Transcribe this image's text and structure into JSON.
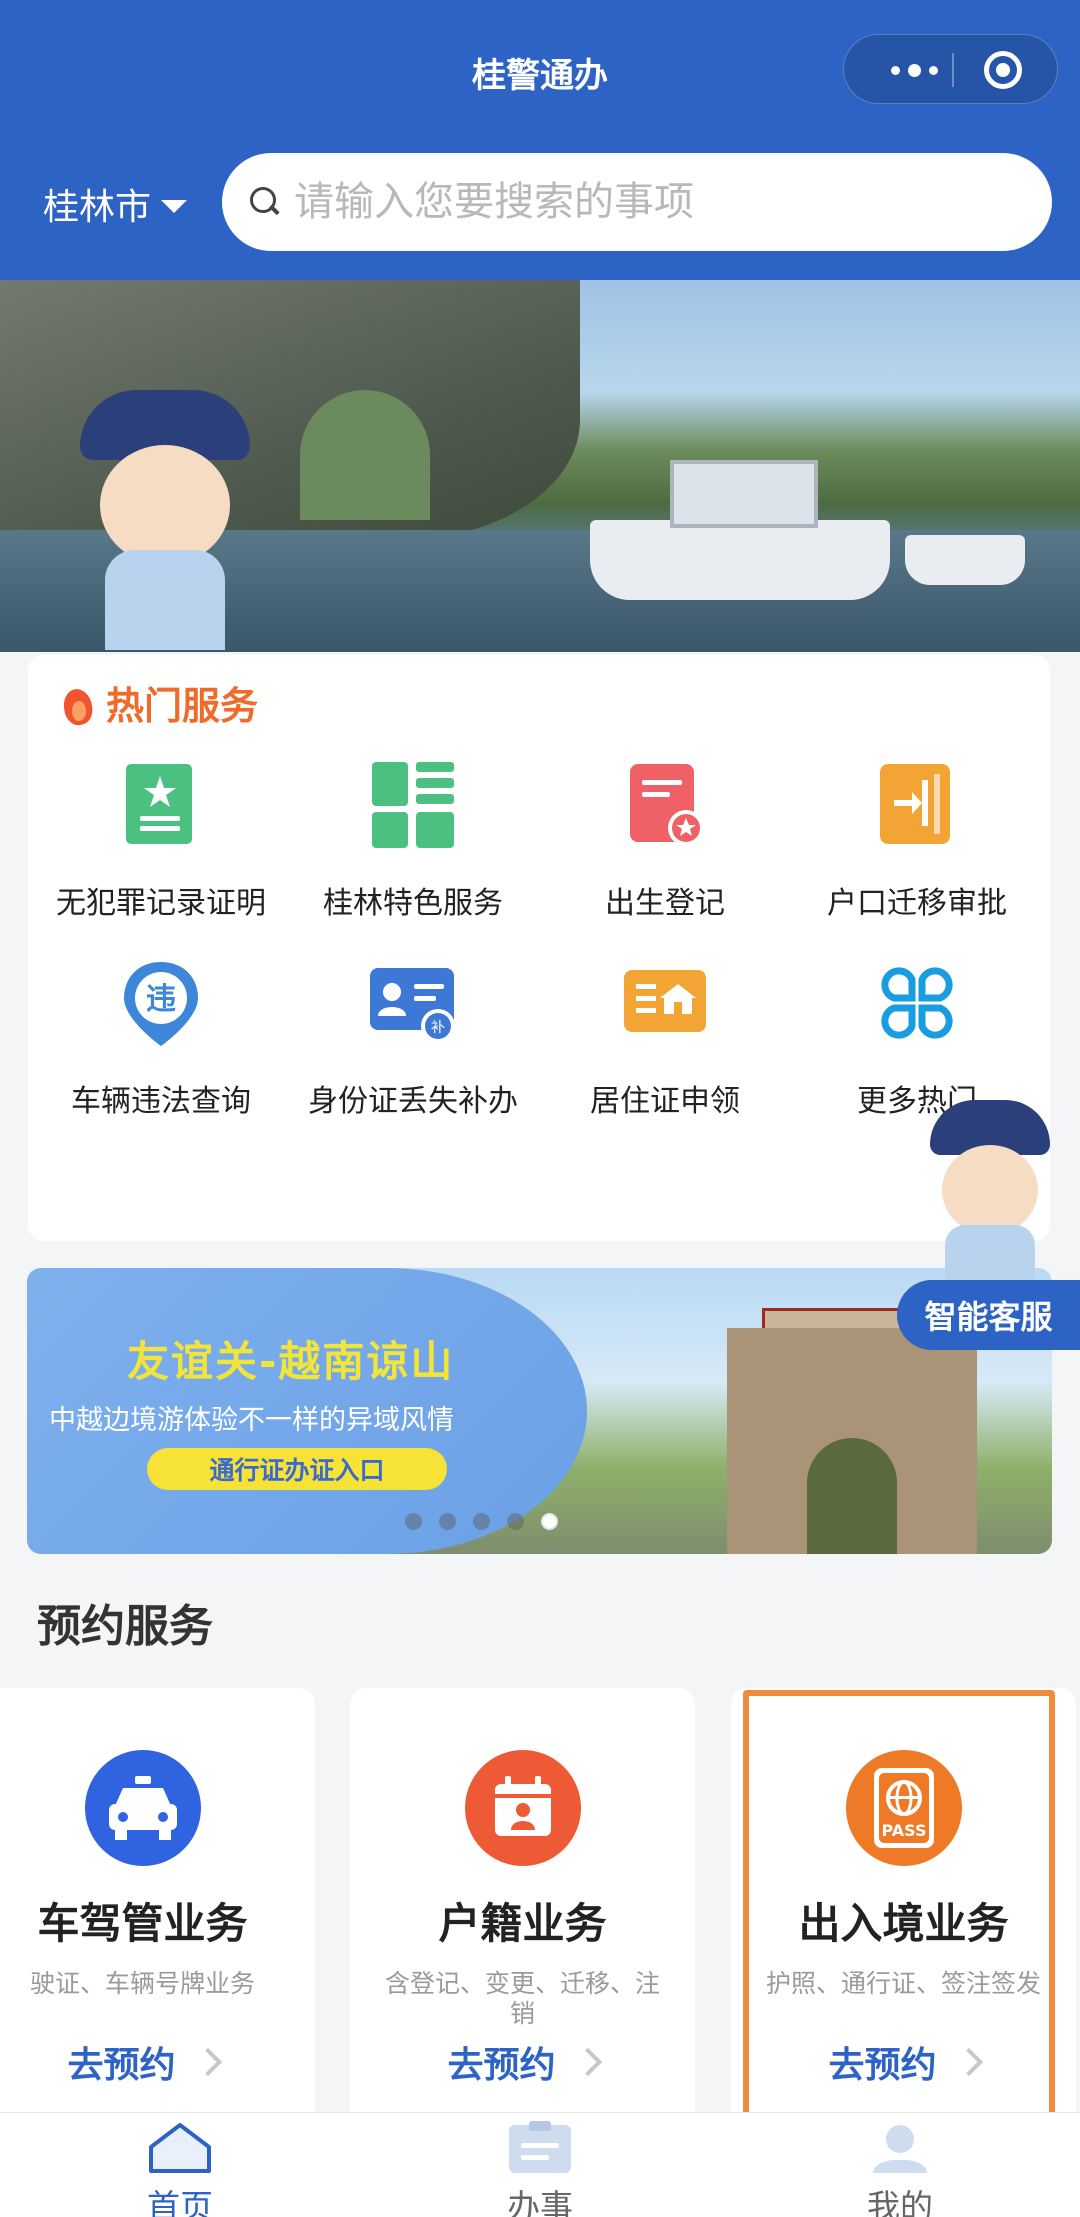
{
  "header": {
    "title": "桂警通办",
    "city": "桂林市",
    "search_placeholder": "请输入您要搜索的事项"
  },
  "hot_services": {
    "title": "热门服务",
    "items": [
      {
        "label": "无犯罪记录证明",
        "icon": "certificate-icon",
        "color": "#4cc081"
      },
      {
        "label": "桂林特色服务",
        "icon": "grid-apps-icon",
        "color": "#4cc081"
      },
      {
        "label": "出生登记",
        "icon": "document-star-icon",
        "color": "#ef6067"
      },
      {
        "label": "户口迁移审批",
        "icon": "migrate-door-icon",
        "color": "#f2a435"
      },
      {
        "label": "车辆违法查询",
        "icon": "violation-pin-icon",
        "color": "#3d86d8"
      },
      {
        "label": "身份证丢失补办",
        "icon": "id-card-icon",
        "color": "#3d78d6"
      },
      {
        "label": "居住证申领",
        "icon": "residence-icon",
        "color": "#f2a435"
      },
      {
        "label": "更多热门",
        "icon": "more-clover-icon",
        "color": "#1a9de0"
      }
    ]
  },
  "assistant": {
    "label": "智能客服"
  },
  "promo": {
    "headline": "友谊关-越南谅山",
    "subline": "中越边境游体验不一样的异域风情",
    "button": "通行证办证入口",
    "slides": 5,
    "active_slide": 5
  },
  "reserve": {
    "title": "预约服务",
    "cards": [
      {
        "name": "车驾管业务",
        "desc": "驶证、车辆号牌业务",
        "action": "去预约",
        "color": "#2f63e0",
        "icon": "car-icon"
      },
      {
        "name": "户籍业务",
        "desc": "含登记、变更、迁移、注销",
        "action": "去预约",
        "color": "#ee5a36",
        "icon": "calendar-person-icon"
      },
      {
        "name": "出入境业务",
        "desc": "护照、通行证、签注签发",
        "action": "去预约",
        "color": "#ee7a28",
        "icon": "passport-icon",
        "pass_text": "PASS"
      }
    ]
  },
  "tabbar": {
    "items": [
      {
        "label": "首页",
        "active": true
      },
      {
        "label": "办事",
        "active": false
      },
      {
        "label": "我的",
        "active": false
      }
    ]
  }
}
